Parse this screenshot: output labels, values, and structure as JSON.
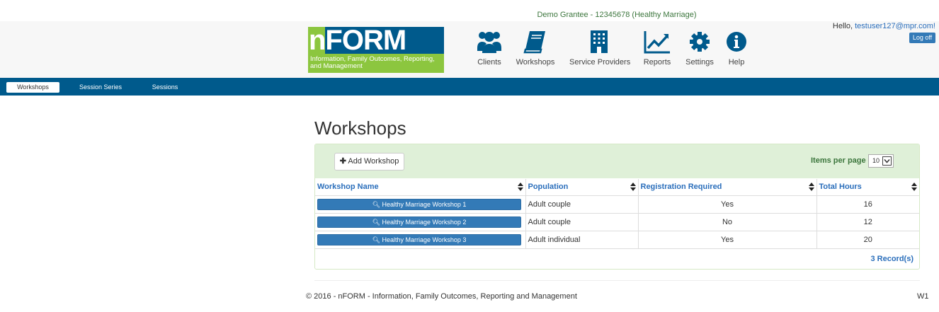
{
  "grantee": "Demo Grantee - 12345678 (Healthy Marriage)",
  "logo": {
    "word": "nFORM",
    "tagline": "Information, Family Outcomes, Reporting, and Management"
  },
  "nav": [
    {
      "label": "Clients",
      "icon": "users-icon"
    },
    {
      "label": "Workshops",
      "icon": "book-icon"
    },
    {
      "label": "Service Providers",
      "icon": "building-icon"
    },
    {
      "label": "Reports",
      "icon": "chart-line-icon"
    },
    {
      "label": "Settings",
      "icon": "gear-icon"
    },
    {
      "label": "Help",
      "icon": "info-icon"
    }
  ],
  "user": {
    "hello": "Hello,",
    "email": "testuser127@mpr.com!",
    "logoff": "Log off"
  },
  "subnav": {
    "tabs": [
      "Workshops",
      "Session Series",
      "Sessions"
    ],
    "active": "Workshops"
  },
  "page_title": "Workshops",
  "toolbar": {
    "add_label": "Add Workshop",
    "items_per_page_label": "Items per page",
    "items_per_page_value": "10"
  },
  "table": {
    "columns": [
      "Workshop Name",
      "Population",
      "Registration Required",
      "Total Hours"
    ],
    "rows": [
      {
        "name": "Healthy Marriage Workshop 1",
        "population": "Adult couple",
        "registration": "Yes",
        "hours": "16"
      },
      {
        "name": "Healthy Marriage Workshop 2",
        "population": "Adult couple",
        "registration": "No",
        "hours": "12"
      },
      {
        "name": "Healthy Marriage Workshop 3",
        "population": "Adult individual",
        "registration": "Yes",
        "hours": "20"
      }
    ],
    "record_count": "3 Record(s)"
  },
  "footer": {
    "copyright": "© 2016 - nFORM - Information, Family Outcomes, Reporting and Management",
    "code": "W1"
  },
  "colors": {
    "brand_blue": "#005a8c",
    "brand_green": "#8cc63f",
    "button_blue": "#337ab7",
    "panel_green": "#dff0d8"
  }
}
